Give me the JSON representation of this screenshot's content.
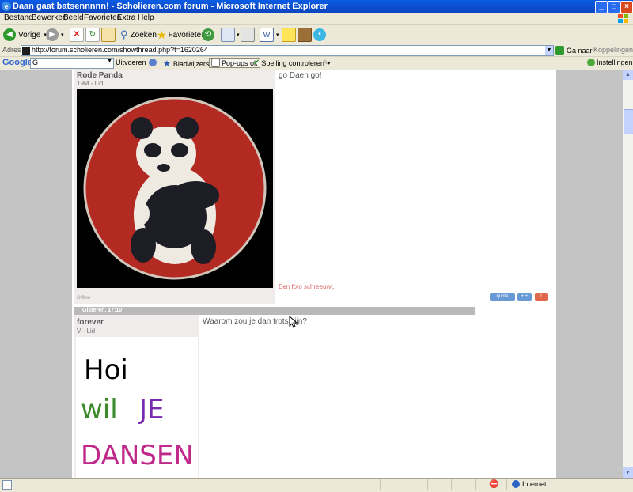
{
  "window": {
    "title": "Daan gaat batsennnnn! - Scholieren.com forum - Microsoft Internet Explorer"
  },
  "menu": [
    "Bestand",
    "Bewerken",
    "Beeld",
    "Favorieten",
    "Extra",
    "Help"
  ],
  "toolbar": {
    "back": "Vorige",
    "search": "Zoeken",
    "favorites": "Favorieten"
  },
  "address": {
    "label": "Adres",
    "url": "http://forum.scholieren.com/showthread.php?t=1620264",
    "go": "Ga naar",
    "links": "Koppelingen"
  },
  "google": {
    "logo": "Google",
    "search_value": "G",
    "run": "Uitvoeren",
    "bookmarks": "Bladwijzers",
    "popups": "Pop-ups ok",
    "spellcheck": "Spelling controleren",
    "settings": "Instellingen"
  },
  "posts": [
    {
      "username": "Rode Panda",
      "user_title": "19M - Lid",
      "message": "go Daen go!",
      "signature": "Een foto schreeuwt.",
      "status": "Offline"
    },
    {
      "date": "Gisteren, 17:10",
      "username": "forever",
      "user_title": "V - Lid",
      "message": "Waarom zou je dan trots zijn?",
      "avatar_text": {
        "line1": "Hoi",
        "line2a": "wil",
        "line2b": "JE",
        "line3": "DANSEN"
      }
    }
  ],
  "buttons": {
    "quote": "quote",
    "multi": "+ +",
    "report": "!"
  },
  "status": {
    "zone": "Internet"
  },
  "colors": {
    "titlebar": "#0b4fd0",
    "panda_bg": "#b22a22"
  }
}
